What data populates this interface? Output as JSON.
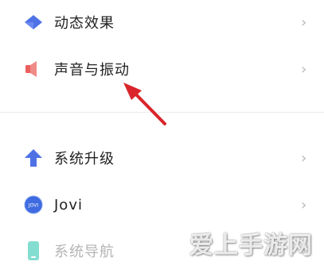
{
  "colors": {
    "accent_blue": "#4e72e6",
    "sound_red": "#e9605e",
    "arrow_red": "#d9252b",
    "chevron": "#b7b7b7",
    "nav_teal": "#83ddd0"
  },
  "settings": {
    "items": [
      {
        "label": "动态效果",
        "icon": "diamond-icon",
        "enabled": true
      },
      {
        "label": "声音与振动",
        "icon": "speaker-icon",
        "enabled": true
      },
      {
        "label": "系统升级",
        "icon": "up-arrow-icon",
        "enabled": true
      },
      {
        "label": "Jovi",
        "icon": "jovi-icon",
        "enabled": true,
        "icon_text": "JOVI"
      },
      {
        "label": "系统导航",
        "icon": "phone-icon",
        "enabled": false
      }
    ],
    "chevron": "›"
  },
  "watermark": "爱上手游网"
}
